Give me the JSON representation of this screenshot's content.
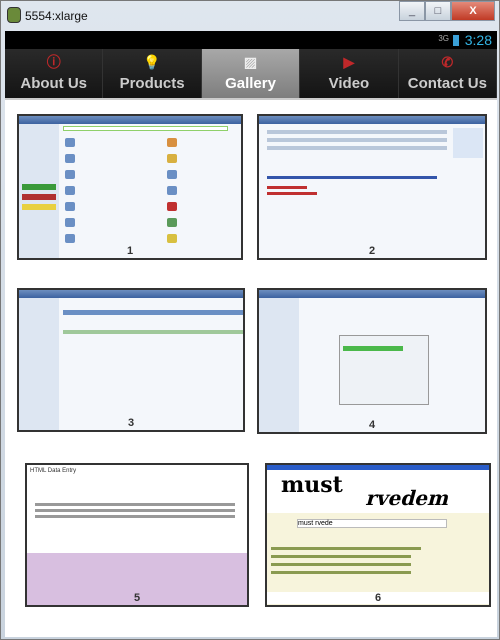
{
  "window": {
    "title": "5554:xlarge",
    "minimize": "_",
    "maximize": "□",
    "close": "X"
  },
  "status_bar": {
    "network": "3G",
    "time": "3:28"
  },
  "tabs": [
    {
      "label": "About Us",
      "icon": "info-icon"
    },
    {
      "label": "Products",
      "icon": "lightbulb-icon"
    },
    {
      "label": "Gallery",
      "icon": "image-icon",
      "active": true
    },
    {
      "label": "Video",
      "icon": "play-icon"
    },
    {
      "label": "Contact Us",
      "icon": "phone-icon"
    }
  ],
  "gallery": [
    {
      "number": "1"
    },
    {
      "number": "2"
    },
    {
      "number": "3"
    },
    {
      "number": "4"
    },
    {
      "number": "5",
      "heading": "HTML Data Entry"
    },
    {
      "number": "6",
      "captcha_words": "must rvedem",
      "captcha_input": "must rvede"
    }
  ]
}
